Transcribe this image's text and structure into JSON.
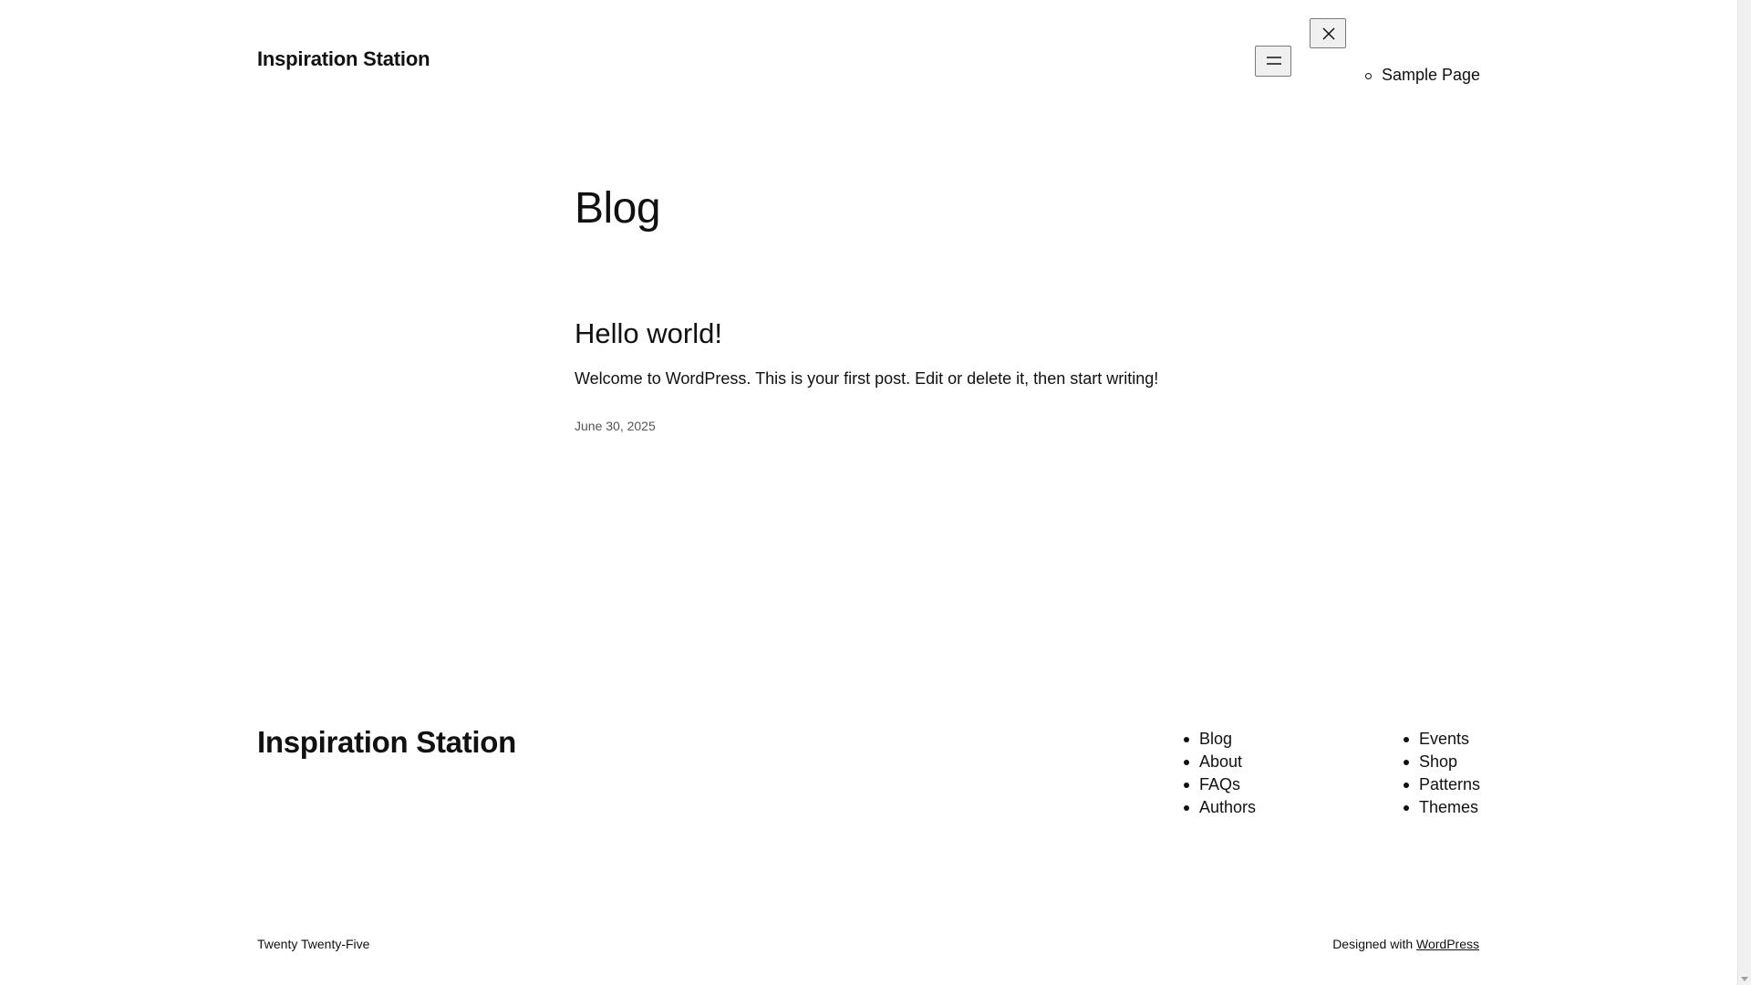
{
  "header": {
    "site_title": "Inspiration Station",
    "menu_open_icon": "hamburger-icon",
    "menu_close_icon": "close-icon",
    "overlay_nav": [
      {
        "label": "Sample Page"
      }
    ]
  },
  "main": {
    "page_title": "Blog",
    "posts": [
      {
        "title": "Hello world!",
        "excerpt": "Welcome to WordPress. This is your first post. Edit or delete it, then start writing!",
        "date": "June 30, 2025"
      }
    ]
  },
  "footer": {
    "site_title": "Inspiration Station",
    "nav_col1": [
      {
        "label": "Blog"
      },
      {
        "label": "About"
      },
      {
        "label": "FAQs"
      },
      {
        "label": "Authors"
      }
    ],
    "nav_col2": [
      {
        "label": "Events"
      },
      {
        "label": "Shop"
      },
      {
        "label": "Patterns"
      },
      {
        "label": "Themes"
      }
    ],
    "credit_left": "Twenty Twenty-Five",
    "credit_prefix": "Designed with",
    "credit_link": "WordPress"
  }
}
